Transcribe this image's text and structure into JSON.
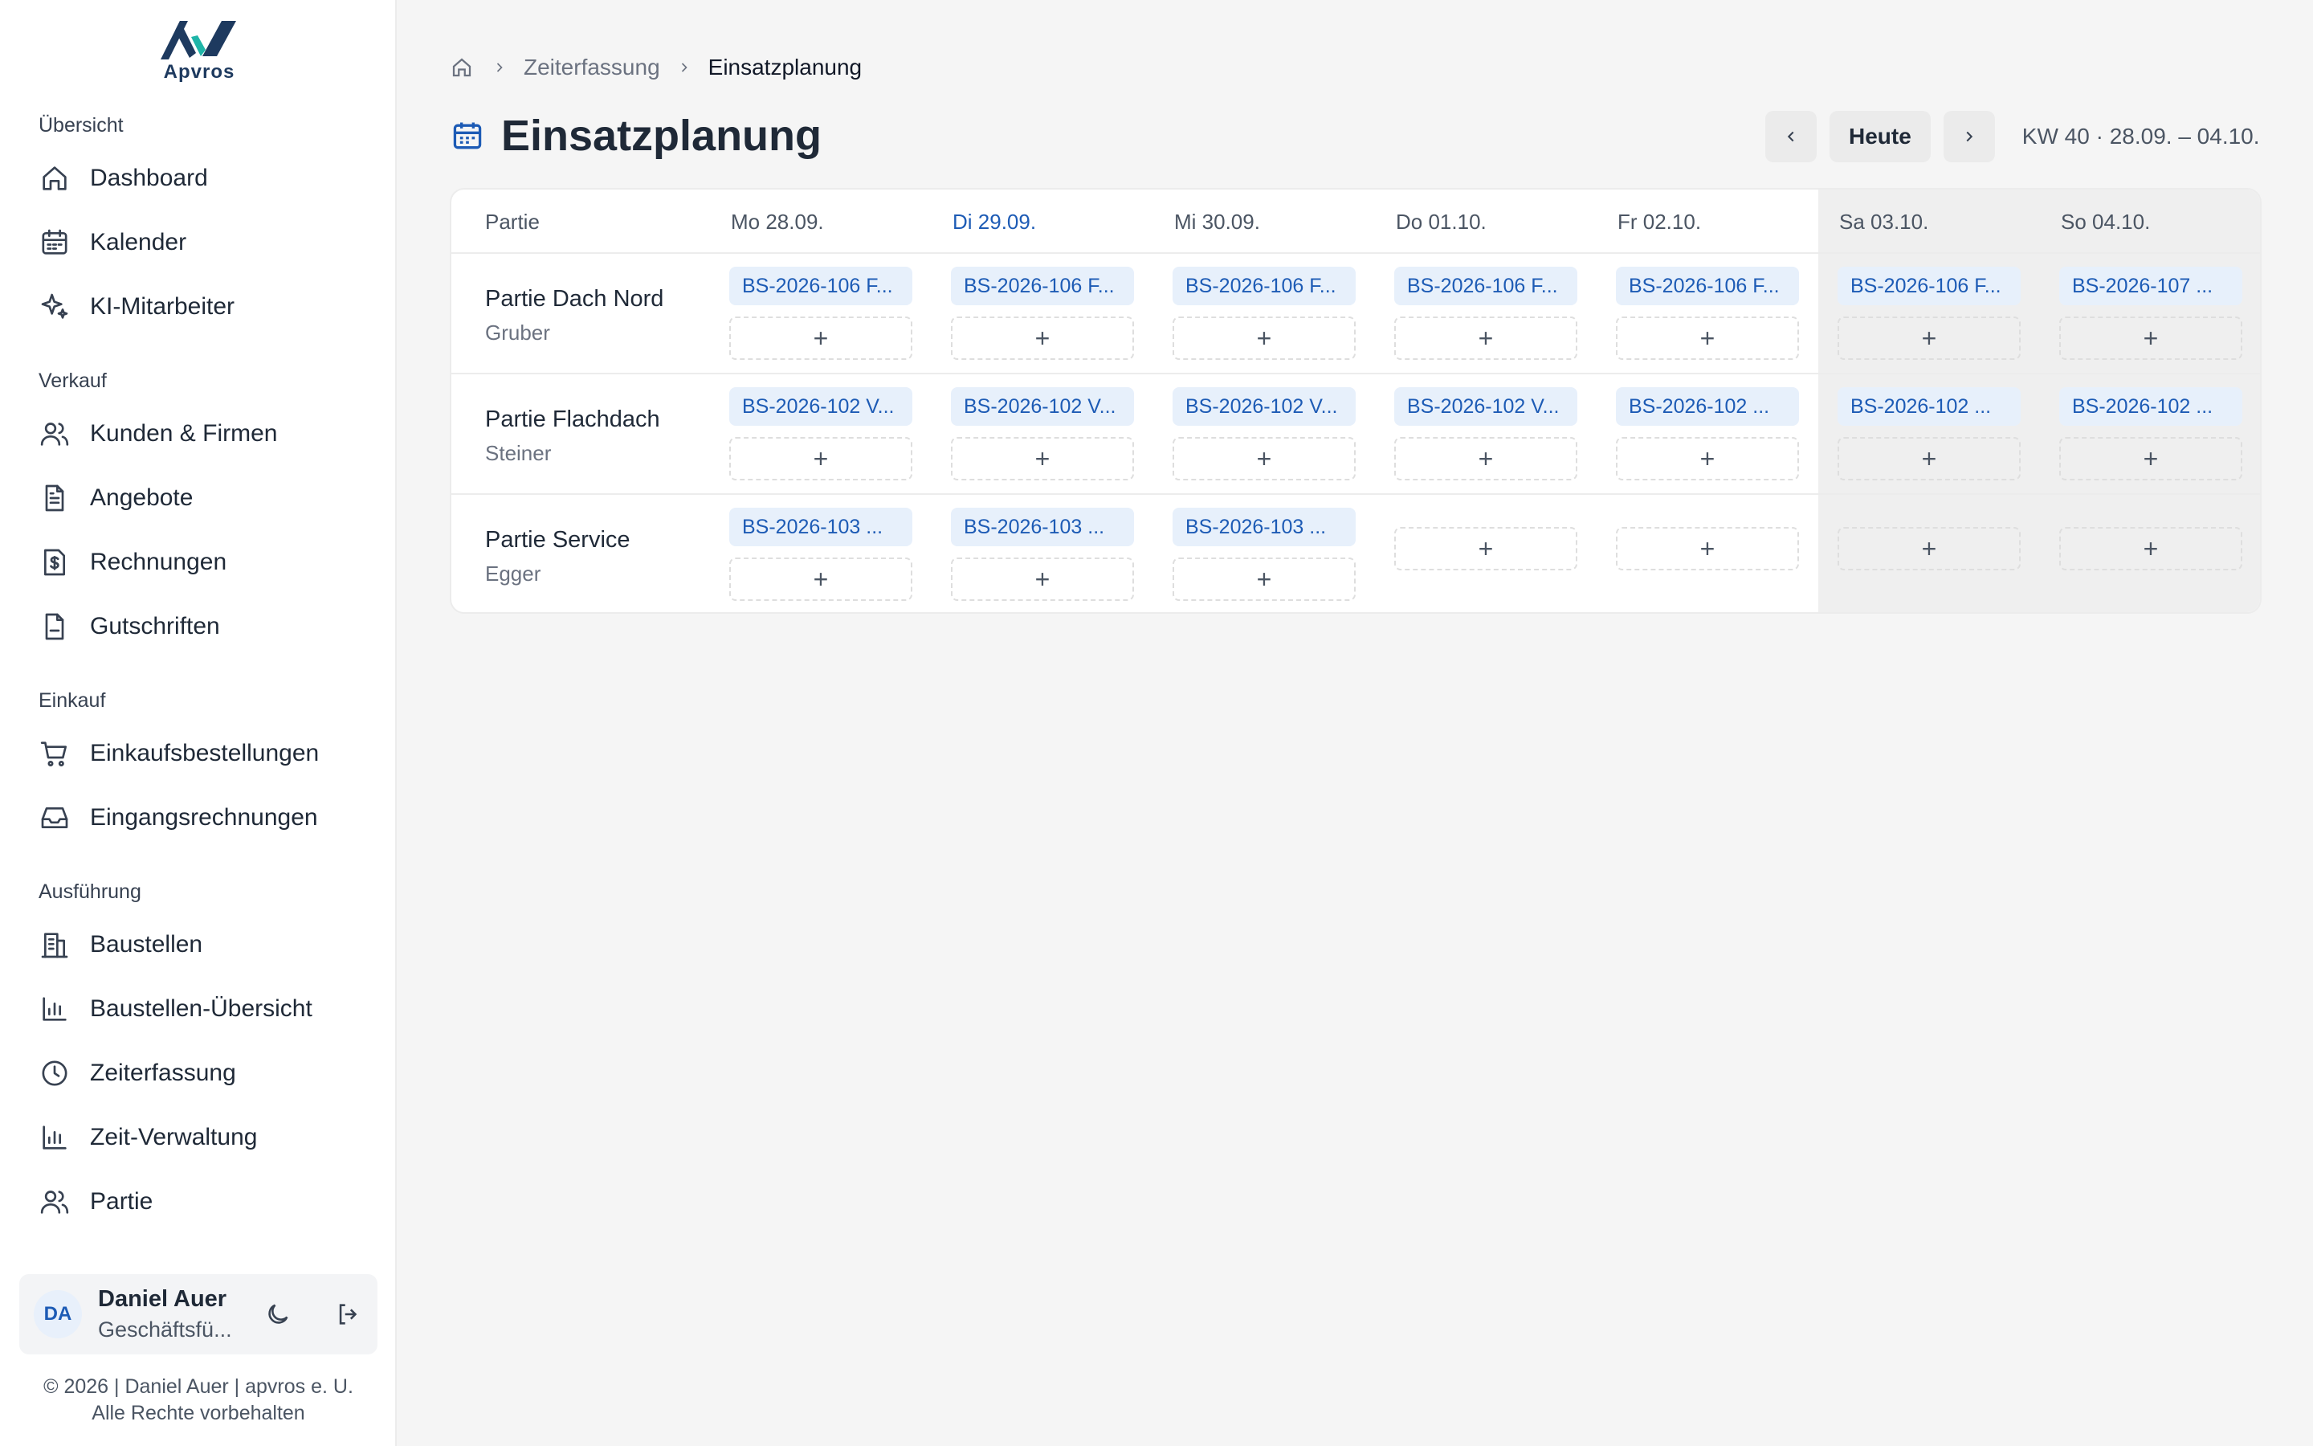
{
  "brand": {
    "name": "Apvros"
  },
  "sidebar": {
    "sections": [
      {
        "label": "Übersicht",
        "items": [
          {
            "label": "Dashboard",
            "icon": "home-icon"
          },
          {
            "label": "Kalender",
            "icon": "calendar-icon"
          },
          {
            "label": "KI-Mitarbeiter",
            "icon": "sparkle-icon"
          }
        ]
      },
      {
        "label": "Verkauf",
        "items": [
          {
            "label": "Kunden & Firmen",
            "icon": "users-icon"
          },
          {
            "label": "Angebote",
            "icon": "document-icon"
          },
          {
            "label": "Rechnungen",
            "icon": "invoice-dollar-icon"
          },
          {
            "label": "Gutschriften",
            "icon": "file-icon"
          }
        ]
      },
      {
        "label": "Einkauf",
        "items": [
          {
            "label": "Einkaufsbestellungen",
            "icon": "cart-icon"
          },
          {
            "label": "Eingangsrechnungen",
            "icon": "inbox-icon"
          }
        ]
      },
      {
        "label": "Ausführung",
        "items": [
          {
            "label": "Baustellen",
            "icon": "building-icon"
          },
          {
            "label": "Baustellen-Übersicht",
            "icon": "bar-chart-icon"
          },
          {
            "label": "Zeiterfassung",
            "icon": "clock-icon"
          },
          {
            "label": "Zeit-Verwaltung",
            "icon": "bar-chart-icon"
          },
          {
            "label": "Partie",
            "icon": "users-icon"
          }
        ]
      }
    ]
  },
  "user": {
    "initials": "DA",
    "name": "Daniel Auer",
    "role": "Geschäftsfü..."
  },
  "footer": {
    "line1": "© 2026 | Daniel Auer | apvros e. U.",
    "line2": "Alle Rechte vorbehalten"
  },
  "breadcrumb": {
    "items": [
      "Zeiterfassung",
      "Einsatzplanung"
    ]
  },
  "page": {
    "title": "Einsatzplanung"
  },
  "week_nav": {
    "today_label": "Heute",
    "week_label": "KW 40 · 28.09. – 04.10."
  },
  "grid": {
    "corner_label": "Partie",
    "days": [
      "Mo 28.09.",
      "Di 29.09.",
      "Mi 30.09.",
      "Do 01.10.",
      "Fr 02.10.",
      "Sa 03.10.",
      "So 04.10."
    ],
    "today_index": 1,
    "add_symbol": "+",
    "rows": [
      {
        "name": "Partie Dach Nord",
        "sub": "Gruber",
        "cells": [
          "BS-2026-106 F...",
          "BS-2026-106 F...",
          "BS-2026-106 F...",
          "BS-2026-106 F...",
          "BS-2026-106 F...",
          "BS-2026-106 F...",
          "BS-2026-107 ..."
        ]
      },
      {
        "name": "Partie Flachdach",
        "sub": "Steiner",
        "cells": [
          "BS-2026-102 V...",
          "BS-2026-102 V...",
          "BS-2026-102 V...",
          "BS-2026-102 V...",
          "BS-2026-102 ...",
          "BS-2026-102 ...",
          "BS-2026-102 ..."
        ]
      },
      {
        "name": "Partie Service",
        "sub": "Egger",
        "cells": [
          "BS-2026-103 ...",
          "BS-2026-103 ...",
          "BS-2026-103 ...",
          "",
          "",
          "",
          ""
        ]
      }
    ]
  },
  "colors": {
    "accent": "#1d5bb5",
    "chip_bg": "#e7f0fb",
    "weekend_bg": "#efefef"
  }
}
